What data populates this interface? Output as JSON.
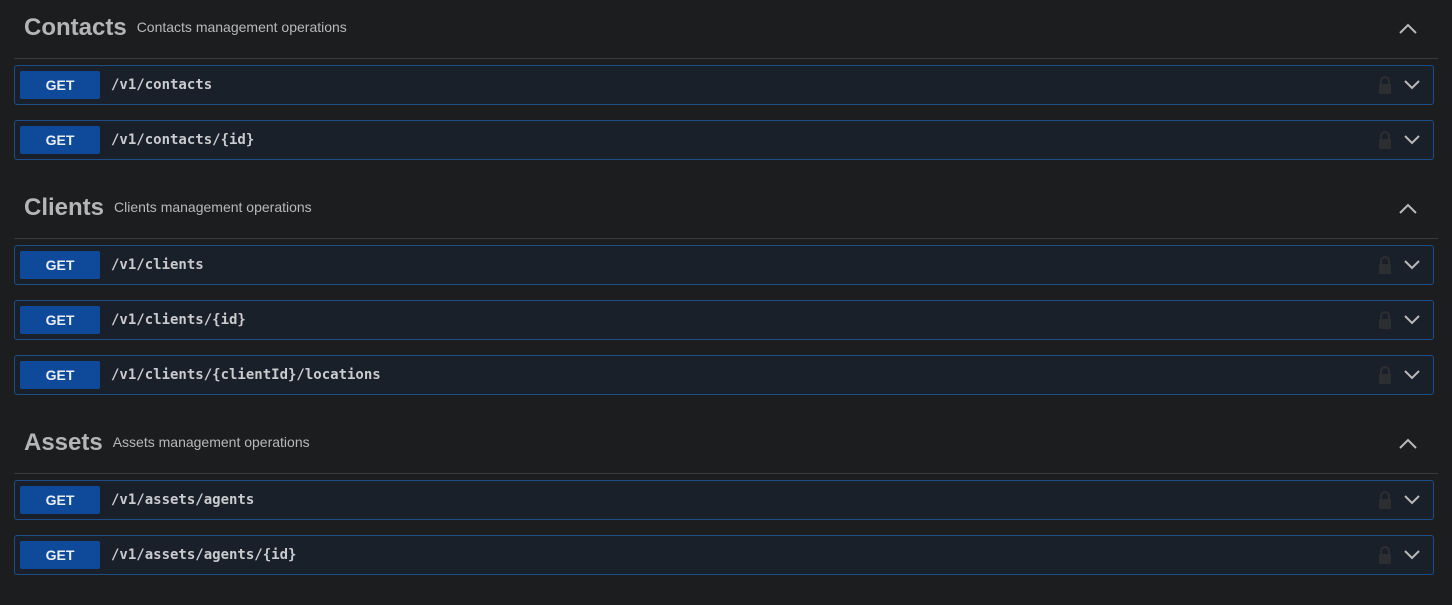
{
  "colors": {
    "background": "#1c1d1f",
    "opBorder": "#1e4d86",
    "opBackground": "#1a202a",
    "methodGet": "#0f4a9a"
  },
  "sections": [
    {
      "title": "Contacts",
      "description": "Contacts management operations",
      "collapse_icon": "chevron-up-icon",
      "operations": [
        {
          "method": "GET",
          "path": "/v1/contacts",
          "lock_icon": "lock-icon",
          "expand_icon": "chevron-down-icon"
        },
        {
          "method": "GET",
          "path": "/v1/contacts/{id}",
          "lock_icon": "lock-icon",
          "expand_icon": "chevron-down-icon"
        }
      ]
    },
    {
      "title": "Clients",
      "description": "Clients management operations",
      "collapse_icon": "chevron-up-icon",
      "operations": [
        {
          "method": "GET",
          "path": "/v1/clients",
          "lock_icon": "lock-icon",
          "expand_icon": "chevron-down-icon"
        },
        {
          "method": "GET",
          "path": "/v1/clients/{id}",
          "lock_icon": "lock-icon",
          "expand_icon": "chevron-down-icon"
        },
        {
          "method": "GET",
          "path": "/v1/clients/{clientId}/locations",
          "lock_icon": "lock-icon",
          "expand_icon": "chevron-down-icon"
        }
      ]
    },
    {
      "title": "Assets",
      "description": "Assets management operations",
      "collapse_icon": "chevron-up-icon",
      "operations": [
        {
          "method": "GET",
          "path": "/v1/assets/agents",
          "lock_icon": "lock-icon",
          "expand_icon": "chevron-down-icon"
        },
        {
          "method": "GET",
          "path": "/v1/assets/agents/{id}",
          "lock_icon": "lock-icon",
          "expand_icon": "chevron-down-icon"
        }
      ]
    }
  ]
}
